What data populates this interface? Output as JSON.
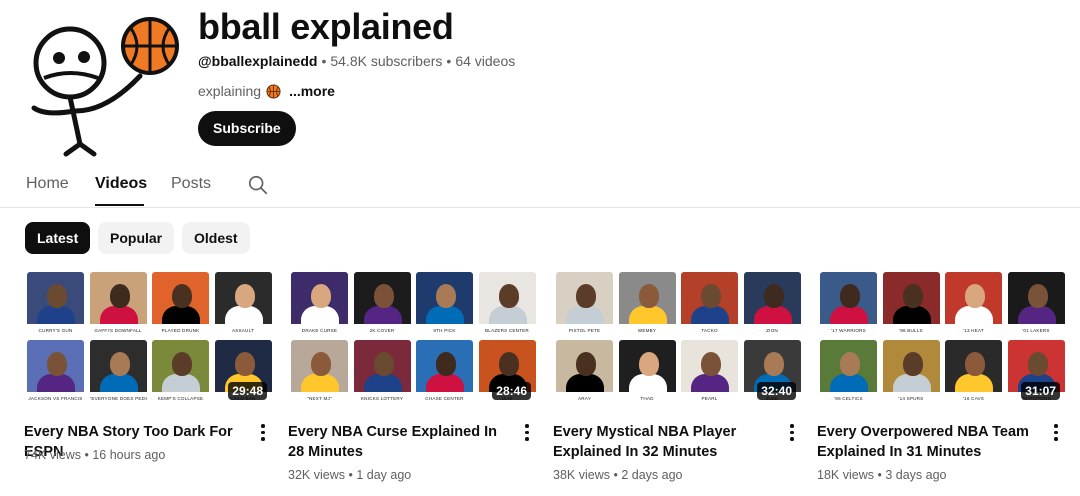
{
  "channel": {
    "title": "bball explained",
    "handle": "@bballexplainedd",
    "subscribers": "54.8K subscribers",
    "videos_count": "64 videos",
    "description": "explaining",
    "more_label": "...more",
    "subscribe_label": "Subscribe"
  },
  "tabs": [
    {
      "label": "Home"
    },
    {
      "label": "Videos",
      "active": true
    },
    {
      "label": "Posts"
    }
  ],
  "chips": [
    {
      "label": "Latest",
      "active": true
    },
    {
      "label": "Popular"
    },
    {
      "label": "Oldest"
    }
  ],
  "videos": [
    {
      "title": "Every NBA Story Too Dark For ESPN",
      "views": "74K views",
      "age": "16 hours ago",
      "duration": "29:48",
      "captions": [
        "CURRY'S GUN",
        "GAFFI'S DOWNFALL",
        "PLAYED DRUNK",
        "ASSAULT",
        "JACKSON VS FRANCIS",
        "\"EVERYONE DOES PEDS\"",
        "KEMP'S COLLAPSE",
        "COLD BAN"
      ]
    },
    {
      "title": "Every NBA Curse Explained In 28 Minutes",
      "views": "32K views",
      "age": "1 day ago",
      "duration": "28:46",
      "captions": [
        "DRAKE CURSE",
        "2K COVER",
        "8TH PICK",
        "BLAZERS CENTER",
        "\"NEXT MJ\"",
        "KNICKS LOTTERY",
        "CHASE CENTER",
        "ULIS"
      ]
    },
    {
      "title": "Every Mystical NBA Player Explained In 32 Minutes",
      "views": "38K views",
      "age": "2 days ago",
      "duration": "32:40",
      "captions": [
        "PISTOL PETE",
        "WEMBY",
        "TACKO",
        "ZION",
        "ARAY",
        "THAD",
        "PEARL",
        "JUKE"
      ]
    },
    {
      "title": "Every Overpowered NBA Team Explained In 31 Minutes",
      "views": "18K views",
      "age": "3 days ago",
      "duration": "31:07",
      "captions": [
        "'17 WARRIORS",
        "'96 BULLS",
        "'13 HEAT",
        "'01 LAKERS",
        "'86 CELTICS",
        "'14 SPURS",
        "'16 CAVS",
        "'04 PISTONS"
      ]
    }
  ],
  "colors": {
    "text_primary": "#0f0f0f",
    "text_secondary": "#606060",
    "chip_bg": "#f2f2f2",
    "basketball": "#f07a23"
  },
  "icons": {
    "search": "search-icon",
    "basketball": "basketball-icon",
    "more": "more-vert-icon"
  }
}
